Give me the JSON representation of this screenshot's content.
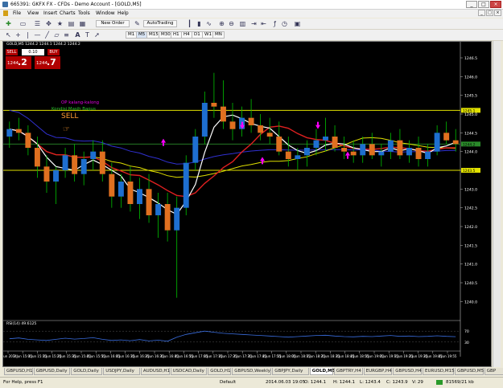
{
  "window": {
    "title": "665391: GKFX FX - CFDs - Demo Account - [GOLD,M5]",
    "buttons": [
      "_",
      "□",
      "×"
    ]
  },
  "menu": [
    "File",
    "View",
    "Insert",
    "Charts",
    "Tools",
    "Window",
    "Help"
  ],
  "toolbar": {
    "new_order": "New Order",
    "auto_trading": "AutoTrading"
  },
  "timeframes": [
    "M1",
    "M5",
    "M15",
    "M30",
    "H1",
    "H4",
    "D1",
    "W1",
    "MN"
  ],
  "chart": {
    "header": "GOLD,M5  1244.2 1244.1 1244.2 1244.2",
    "rsi_label": "RSI(14) 49.6125",
    "trade_panel": {
      "sell": "SELL",
      "buy": "BUY",
      "lot": "0.10",
      "bid_small": "1244",
      "bid_big": ".2",
      "ask_small": "1244",
      "ask_big": ".7"
    },
    "annotations": {
      "op": "OP kalang-kalong",
      "kondisi": "Kondisi Masih Bagus",
      "sell": "SELL"
    },
    "price_axis": [
      "1246.5",
      "1246.0",
      "1245.5",
      "1245.0",
      "1244.5",
      "1244.0",
      "1243.5",
      "1243.0",
      "1242.5",
      "1242.0",
      "1241.5",
      "1241.0",
      "1240.5",
      "1240.0"
    ],
    "price_tags": {
      "top": "1245.1",
      "mid": "1244.2",
      "low": "1243.5"
    },
    "rsi_axis": [
      "70",
      "30"
    ],
    "time_axis": [
      "3 Jun 2014",
      "3 Jun 15:05",
      "3 Jun 15:15",
      "3 Jun 15:25",
      "3 Jun 15:35",
      "3 Jun 15:45",
      "3 Jun 15:55",
      "3 Jun 16:05",
      "3 Jun 16:15",
      "3 Jun 16:25",
      "3 Jun 16:35",
      "3 Jun 16:45",
      "3 Jun 16:55",
      "3 Jun 17:05",
      "3 Jun 17:15",
      "3 Jun 17:25",
      "3 Jun 17:35",
      "3 Jun 17:45",
      "3 Jun 17:55",
      "3 Jun 18:05",
      "3 Jun 18:15",
      "3 Jun 18:25",
      "3 Jun 18:35",
      "3 Jun 18:45",
      "3 Jun 18:55",
      "3 Jun 19:05",
      "3 Jun 19:15",
      "3 Jun 19:25",
      "3 Jun 19:35",
      "3 Jun 19:45",
      "3 Jun 19:55"
    ],
    "colors": {
      "bull": "#1e6fd0",
      "bear": "#e07020",
      "wick": "#00c000",
      "ma_red": "#e02020",
      "ma_yellow": "#e0e000",
      "ma_white": "#ffffff",
      "ma_blue": "#3030d0",
      "level": "#e0e000",
      "arrow": "#ff00ff"
    }
  },
  "chart_data": {
    "type": "candlestick",
    "symbol": "GOLD",
    "timeframe": "M5",
    "ylim": [
      1239.6,
      1246.8
    ],
    "candles": [
      [
        1244.4,
        1244.8,
        1244.1,
        1244.6
      ],
      [
        1244.6,
        1244.9,
        1244.3,
        1244.5
      ],
      [
        1244.5,
        1244.7,
        1243.9,
        1244.1
      ],
      [
        1244.1,
        1244.4,
        1243.3,
        1243.6
      ],
      [
        1243.6,
        1243.9,
        1242.9,
        1243.2
      ],
      [
        1243.2,
        1243.6,
        1242.6,
        1243.5
      ],
      [
        1243.5,
        1244.1,
        1243.3,
        1243.9
      ],
      [
        1243.9,
        1244.2,
        1243.2,
        1243.4
      ],
      [
        1243.4,
        1244.0,
        1243.1,
        1243.8
      ],
      [
        1243.8,
        1244.3,
        1243.5,
        1244.0
      ],
      [
        1244.0,
        1244.3,
        1243.2,
        1243.4
      ],
      [
        1243.4,
        1243.7,
        1242.5,
        1242.8
      ],
      [
        1242.8,
        1243.4,
        1242.5,
        1243.2
      ],
      [
        1243.2,
        1243.6,
        1242.4,
        1242.6
      ],
      [
        1242.6,
        1243.3,
        1242.2,
        1243.0
      ],
      [
        1243.0,
        1243.4,
        1242.1,
        1242.3
      ],
      [
        1242.3,
        1242.9,
        1241.7,
        1242.6
      ],
      [
        1242.6,
        1242.9,
        1241.6,
        1241.9
      ],
      [
        1241.9,
        1242.8,
        1240.1,
        1242.5
      ],
      [
        1242.5,
        1243.9,
        1242.3,
        1243.7
      ],
      [
        1243.7,
        1244.6,
        1243.5,
        1244.4
      ],
      [
        1244.4,
        1245.6,
        1244.2,
        1245.3
      ],
      [
        1245.3,
        1246.1,
        1244.9,
        1245.2
      ],
      [
        1245.2,
        1245.9,
        1244.6,
        1244.8
      ],
      [
        1244.8,
        1245.3,
        1244.3,
        1244.6
      ],
      [
        1244.6,
        1245.2,
        1244.4,
        1244.9
      ],
      [
        1244.9,
        1245.4,
        1244.5,
        1244.7
      ],
      [
        1244.7,
        1245.0,
        1244.3,
        1244.5
      ],
      [
        1244.5,
        1244.9,
        1244.2,
        1244.4
      ],
      [
        1244.4,
        1244.8,
        1243.9,
        1244.0
      ],
      [
        1244.0,
        1244.4,
        1243.6,
        1243.8
      ],
      [
        1243.8,
        1244.1,
        1243.5,
        1243.9
      ],
      [
        1243.9,
        1244.3,
        1243.6,
        1244.1
      ],
      [
        1244.1,
        1244.6,
        1243.9,
        1244.3
      ],
      [
        1244.3,
        1244.9,
        1244.0,
        1244.4
      ],
      [
        1244.4,
        1244.7,
        1244.0,
        1244.1
      ],
      [
        1244.1,
        1244.4,
        1243.8,
        1244.0
      ],
      [
        1244.0,
        1244.3,
        1243.7,
        1243.9
      ],
      [
        1243.9,
        1244.4,
        1243.7,
        1244.2
      ],
      [
        1244.2,
        1244.5,
        1243.8,
        1243.9
      ],
      [
        1243.9,
        1244.2,
        1243.6,
        1244.0
      ],
      [
        1244.0,
        1244.5,
        1243.8,
        1244.3
      ],
      [
        1244.3,
        1244.6,
        1243.8,
        1243.9
      ],
      [
        1243.9,
        1244.3,
        1243.7,
        1244.1
      ],
      [
        1244.1,
        1244.4,
        1243.6,
        1243.8
      ],
      [
        1243.8,
        1244.2,
        1243.6,
        1244.0
      ],
      [
        1244.0,
        1244.7,
        1243.9,
        1244.5
      ],
      [
        1244.5,
        1244.8,
        1244.2,
        1244.3
      ],
      [
        1244.3,
        1244.6,
        1244.0,
        1244.2
      ]
    ],
    "levels": [
      1245.1,
      1244.2,
      1243.5
    ],
    "rsi": [
      42,
      45,
      40,
      38,
      36,
      40,
      44,
      41,
      43,
      46,
      40,
      36,
      38,
      35,
      39,
      34,
      37,
      33,
      48,
      58,
      64,
      70,
      66,
      62,
      60,
      58,
      56,
      54,
      52,
      50,
      48,
      50,
      52,
      54,
      55,
      52,
      50,
      49,
      51,
      50,
      52,
      54,
      51,
      52,
      50,
      51,
      53,
      51,
      49.6
    ]
  }
}
